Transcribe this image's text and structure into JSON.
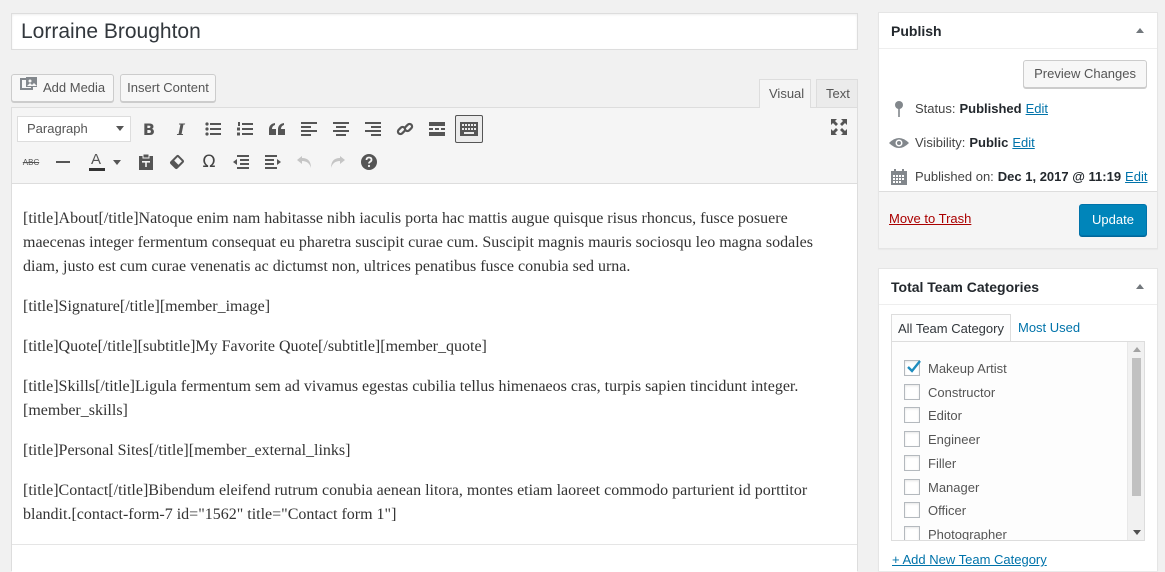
{
  "post": {
    "title": "Lorraine Broughton"
  },
  "media_buttons": {
    "add_media": "Add Media",
    "insert_content": "Insert Content"
  },
  "editor_tabs": {
    "visual": "Visual",
    "text": "Text",
    "active": "Visual"
  },
  "toolbar": {
    "format_select": "Paragraph",
    "row1_icons": [
      "bold-icon",
      "italic-icon",
      "bulleted-list-icon",
      "numbered-list-icon",
      "blockquote-icon",
      "align-left-icon",
      "align-center-icon",
      "align-right-icon",
      "insert-link-icon",
      "read-more-icon",
      "toolbar-toggle-icon"
    ],
    "row2_icons": [
      "strikethrough-icon",
      "horizontal-line-icon",
      "text-color-icon",
      "paste-as-text-icon",
      "clear-formatting-icon",
      "special-character-icon",
      "outdent-icon",
      "indent-icon",
      "undo-icon",
      "redo-icon",
      "keyboard-shortcuts-icon"
    ],
    "fullscreen_icon": "distraction-free-icon",
    "bold_glyph": "B",
    "italic_glyph": "I",
    "special_char_glyph": "Ω",
    "text_color_glyph": "A",
    "strike_glyph": "ABC"
  },
  "content": {
    "paragraphs": [
      "[title]About[/title]Natoque enim nam habitasse nibh iaculis porta hac mattis augue quisque risus rhoncus, fusce posuere maecenas integer fermentum consequat eu pharetra suscipit curae cum. Suscipit magnis mauris sociosqu leo magna sodales diam, justo est cum curae venenatis ac dictumst non, ultrices penatibus fusce conubia sed urna.",
      "[title]Signature[/title][member_image]",
      "[title]Quote[/title][subtitle]My Favorite Quote[/subtitle][member_quote]",
      "[title]Skills[/title]Ligula fermentum sem ad vivamus egestas cubilia tellus himenaeos cras, turpis sapien tincidunt integer.[member_skills]",
      "[title]Personal Sites[/title][member_external_links]",
      "[title]Contact[/title]Bibendum eleifend rutrum conubia aenean litora, montes etiam laoreet commodo parturient id porttitor blandit.[contact-form-7 id=\"1562\" title=\"Contact form 1\"]"
    ]
  },
  "publish_box": {
    "heading": "Publish",
    "preview_button": "Preview Changes",
    "status_label": "Status:",
    "status_value": "Published",
    "visibility_label": "Visibility:",
    "visibility_value": "Public",
    "published_label": "Published on:",
    "published_value": "Dec 1, 2017 @ 11:19",
    "edit_link": "Edit",
    "trash_link": "Move to Trash",
    "update_button": "Update"
  },
  "categories_box": {
    "heading": "Total Team Categories",
    "tab_all": "All Team Category",
    "tab_most_used": "Most Used",
    "items": [
      {
        "label": "Makeup Artist",
        "checked": true
      },
      {
        "label": "Constructor",
        "checked": false
      },
      {
        "label": "Editor",
        "checked": false
      },
      {
        "label": "Engineer",
        "checked": false
      },
      {
        "label": "Filler",
        "checked": false
      },
      {
        "label": "Manager",
        "checked": false
      },
      {
        "label": "Officer",
        "checked": false
      },
      {
        "label": "Photographer",
        "checked": false
      }
    ],
    "add_new_link": "+ Add New Team Category"
  },
  "colors": {
    "accent": "#0085ba",
    "link": "#0073aa",
    "trash": "#aa0000",
    "check": "#1e8cbe"
  }
}
